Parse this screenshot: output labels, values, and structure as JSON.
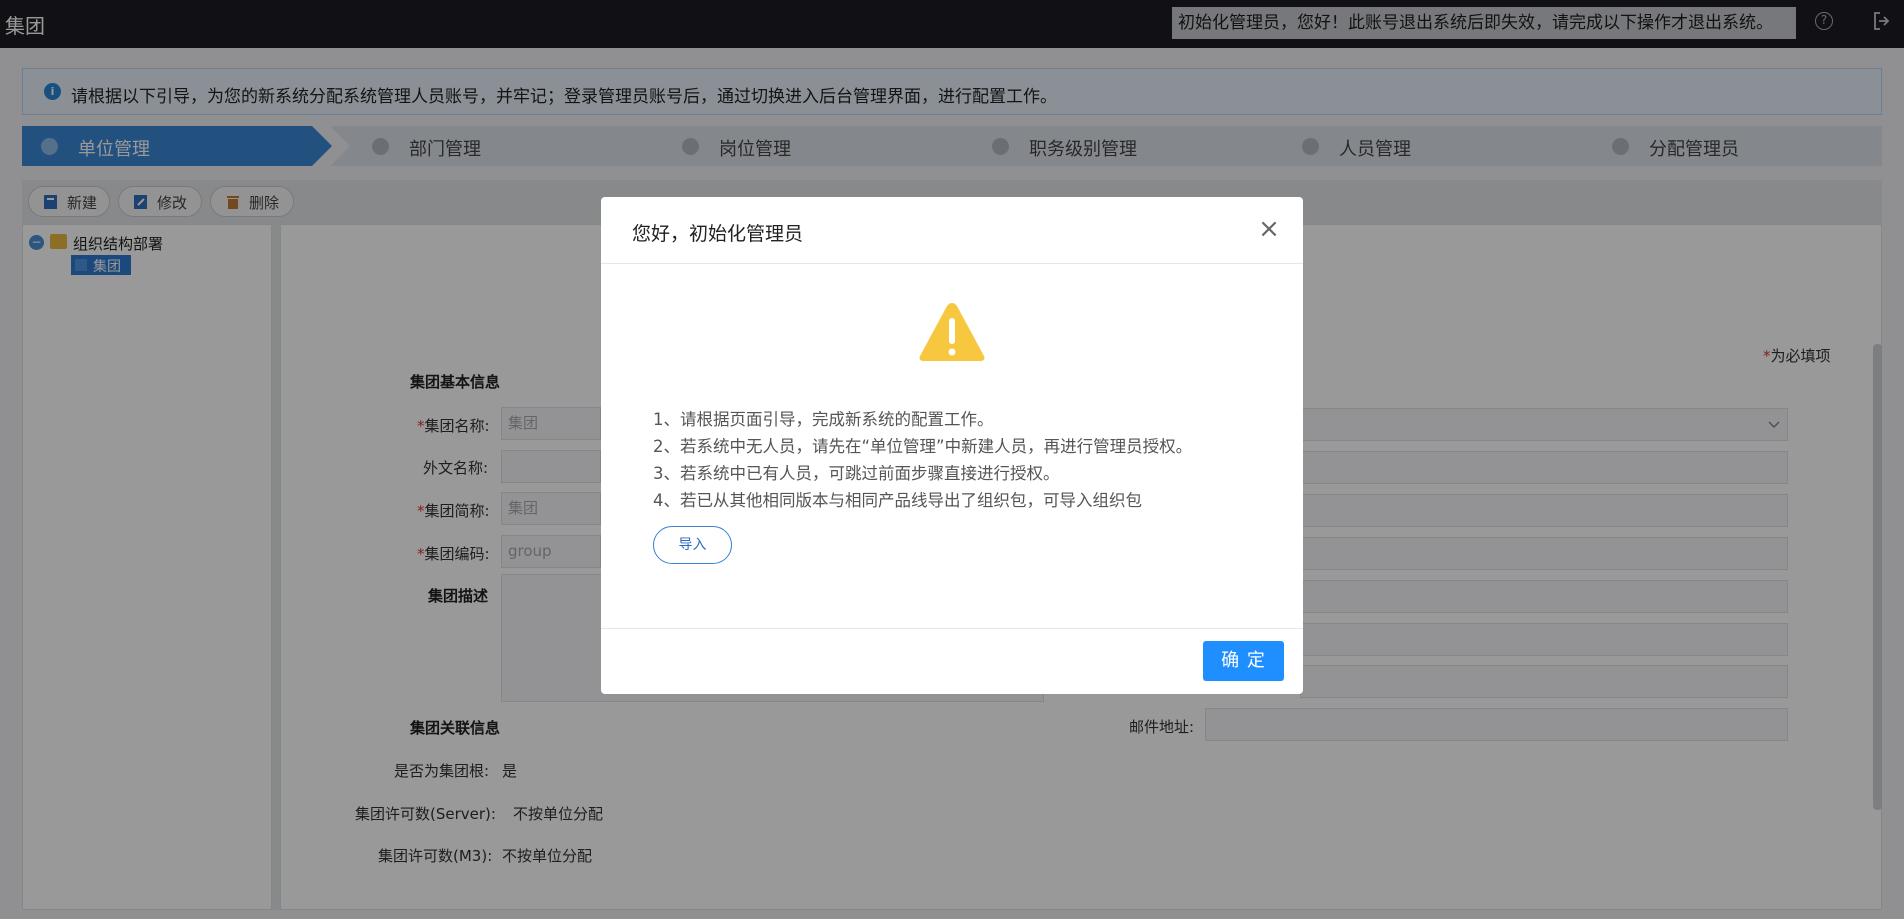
{
  "app": {
    "title": "集团",
    "notice": "初始化管理员，您好！此账号退出系统后即失效，请完成以下操作才退出系统。",
    "help_glyph": "?"
  },
  "info": {
    "icon_glyph": "i",
    "text": "请根据以下引导，为您的新系统分配系统管理人员账号，并牢记；登录管理员账号后，通过切换进入后台管理界面，进行配置工作。"
  },
  "steps": [
    {
      "label": "单位管理",
      "active": true
    },
    {
      "label": "部门管理",
      "active": false
    },
    {
      "label": "岗位管理",
      "active": false
    },
    {
      "label": "职务级别管理",
      "active": false
    },
    {
      "label": "人员管理",
      "active": false
    },
    {
      "label": "分配管理员",
      "active": false
    }
  ],
  "toolbar": {
    "new_label": "新建",
    "edit_label": "修改",
    "delete_label": "删除"
  },
  "tree": {
    "collapse_glyph": "−",
    "root_label": "组织结构部署",
    "child_label": "集团"
  },
  "form": {
    "required_star": "*",
    "required_note": "为必填项",
    "basic_title": "集团基本信息",
    "name_label": "集团名称:",
    "name_value": "集团",
    "foreign_label": "外文名称:",
    "short_label": "集团简称:",
    "short_value": "集团",
    "code_label": "集团编码:",
    "code_value": "group",
    "desc_label": "集团描述",
    "mail_label": "邮件地址:",
    "related_title": "集团关联信息",
    "is_root_label": "是否为集团根:",
    "is_root_value": "是",
    "server_label": "集团许可数(Server):",
    "server_value": "不按单位分配",
    "m3_label": "集团许可数(M3):",
    "m3_value": "不按单位分配"
  },
  "modal": {
    "title": "您好，初始化管理员",
    "close_glyph": "×",
    "lines": [
      "1、请根据页面引导，完成新系统的配置工作。",
      "2、若系统中无人员，请先在“单位管理”中新建人员，再进行管理员授权。",
      "3、若系统中已有人员，可跳过前面步骤直接进行授权。",
      "4、若已从其他相同版本与相同产品线导出了组织包，可导入组织包"
    ],
    "import_label": "导入",
    "ok_label": "确 定"
  },
  "colors": {
    "topbar": "#1b1c24",
    "step_active": "#3a86d4",
    "step_inactive": "#dde2ea",
    "primary": "#1f8fff",
    "warning": "#f7c83f",
    "required": "#d9363e"
  }
}
